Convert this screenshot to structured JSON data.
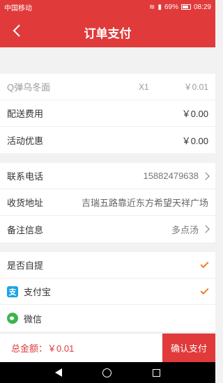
{
  "status_bar": {
    "carrier": "中国移动",
    "battery": "69%",
    "time": "08:29"
  },
  "header": {
    "title": "订单支付"
  },
  "items": [
    {
      "name": "Q弹乌冬面",
      "qty": "X1",
      "price": "￥0.01"
    }
  ],
  "fees": {
    "delivery_label": "配送费用",
    "delivery_value": "￥0.00",
    "discount_label": "活动优惠",
    "discount_value": "￥0.00"
  },
  "contact": {
    "phone_label": "联系电话",
    "phone_value": "15882479638",
    "address_label": "收货地址",
    "address_value": "吉瑞五路靠近东方希望天祥广场",
    "note_label": "备注信息",
    "note_value": "多点汤"
  },
  "options": {
    "pickup_label": "是否自提",
    "alipay_label": "支付宝",
    "alipay_icon": "支",
    "wechat_label": "微信"
  },
  "footer": {
    "total": "总金额：￥0.01",
    "confirm": "确认支付"
  },
  "colors": {
    "primary": "#e03a3a",
    "check": "#f47b20",
    "alipay": "#1aa3e8",
    "wechat": "#3bb54a"
  }
}
